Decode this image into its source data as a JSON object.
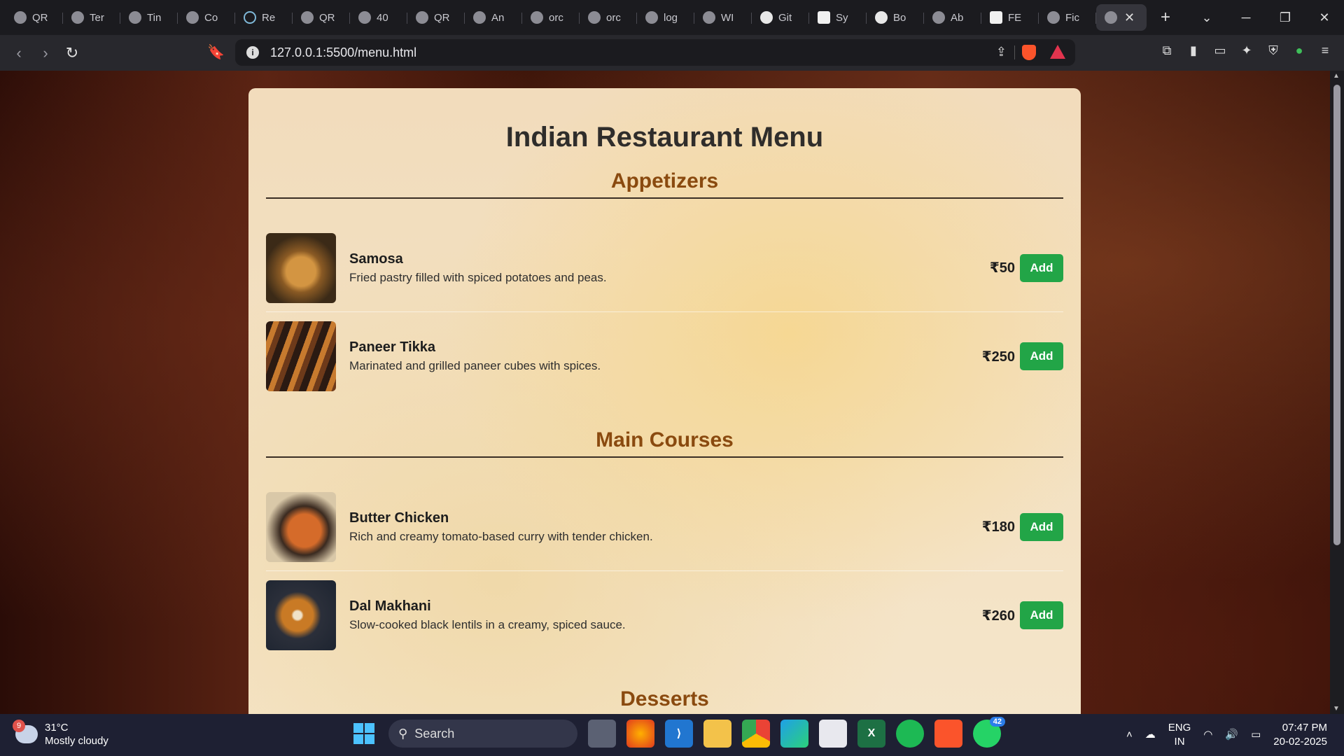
{
  "browser": {
    "tabs": [
      {
        "title": "QR",
        "icon": "globe-icon"
      },
      {
        "title": "Ter",
        "icon": "globe-icon"
      },
      {
        "title": "Tin",
        "icon": "globe-icon"
      },
      {
        "title": "Co",
        "icon": "globe-icon"
      },
      {
        "title": "Re",
        "icon": "react-icon"
      },
      {
        "title": "QR",
        "icon": "globe-icon"
      },
      {
        "title": "40",
        "icon": "globe-icon"
      },
      {
        "title": "QR",
        "icon": "globe-icon"
      },
      {
        "title": "An",
        "icon": "globe-icon"
      },
      {
        "title": "orc",
        "icon": "globe-icon"
      },
      {
        "title": "orc",
        "icon": "globe-icon"
      },
      {
        "title": "log",
        "icon": "globe-icon"
      },
      {
        "title": "WI",
        "icon": "globe-icon"
      },
      {
        "title": "Git",
        "icon": "github-icon"
      },
      {
        "title": "Sy",
        "icon": "notion-icon"
      },
      {
        "title": "Bo",
        "icon": "github-icon"
      },
      {
        "title": "Ab",
        "icon": "globe-icon"
      },
      {
        "title": "FE",
        "icon": "notion-icon"
      },
      {
        "title": "Fic",
        "icon": "globe-icon"
      }
    ],
    "url": "127.0.0.1:5500/menu.html"
  },
  "page": {
    "title": "Indian Restaurant Menu",
    "add_label": "Add",
    "sections": [
      {
        "title": "Appetizers",
        "items": [
          {
            "name": "Samosa",
            "desc": "Fried pastry filled with spiced potatoes and peas.",
            "price": "₹50"
          },
          {
            "name": "Paneer Tikka",
            "desc": "Marinated and grilled paneer cubes with spices.",
            "price": "₹250"
          }
        ]
      },
      {
        "title": "Main Courses",
        "items": [
          {
            "name": "Butter Chicken",
            "desc": "Rich and creamy tomato-based curry with tender chicken.",
            "price": "₹180"
          },
          {
            "name": "Dal Makhani",
            "desc": "Slow-cooked black lentils in a creamy, spiced sauce.",
            "price": "₹260"
          }
        ]
      },
      {
        "title": "Desserts"
      }
    ]
  },
  "taskbar": {
    "weather_badge": "9",
    "temperature": "31°C",
    "condition": "Mostly cloudy",
    "search_placeholder": "Search",
    "whatsapp_badge": "42",
    "lang_top": "ENG",
    "lang_bottom": "IN",
    "time": "07:47 PM",
    "date": "20-02-2025"
  },
  "colors": {
    "accent_button": "#22a547",
    "section_heading": "#8a4a0f",
    "title_text": "#2f2d2b"
  }
}
